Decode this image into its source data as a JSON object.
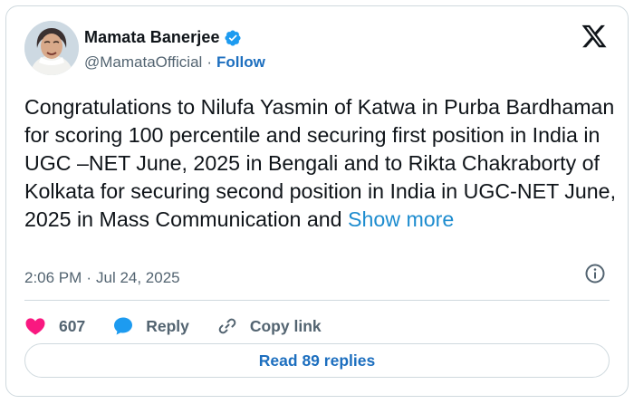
{
  "author": {
    "display_name": "Mamata Banerjee",
    "handle": "@MamataOfficial",
    "separator": "·",
    "follow_label": "Follow",
    "verified_icon": "verified-badge-icon",
    "avatar_icon": "user-avatar"
  },
  "tweet": {
    "text": "Congratulations to Nilufa Yasmin of Katwa in Purba Bardhaman for scoring 100 percentile and securing first position in India in UGC –NET June, 2025 in Bengali and to Rikta Chakraborty of Kolkata for securing second position in India in UGC-NET June, 2025 in Mass Communication and ",
    "show_more_label": "Show more",
    "time": "2:06 PM",
    "separator": "·",
    "date": "Jul 24, 2025"
  },
  "actions": {
    "like_count": "607",
    "reply_label": "Reply",
    "copy_link_label": "Copy link"
  },
  "footer": {
    "read_replies_label": "Read 89 replies"
  },
  "colors": {
    "accent": "#1d9bf0",
    "like": "#f91880",
    "text_primary": "#0f1419",
    "text_secondary": "#536471",
    "border": "#cfd9de"
  },
  "icons": [
    "x-logo-icon",
    "info-icon",
    "heart-icon",
    "reply-bubble-icon",
    "link-icon"
  ]
}
